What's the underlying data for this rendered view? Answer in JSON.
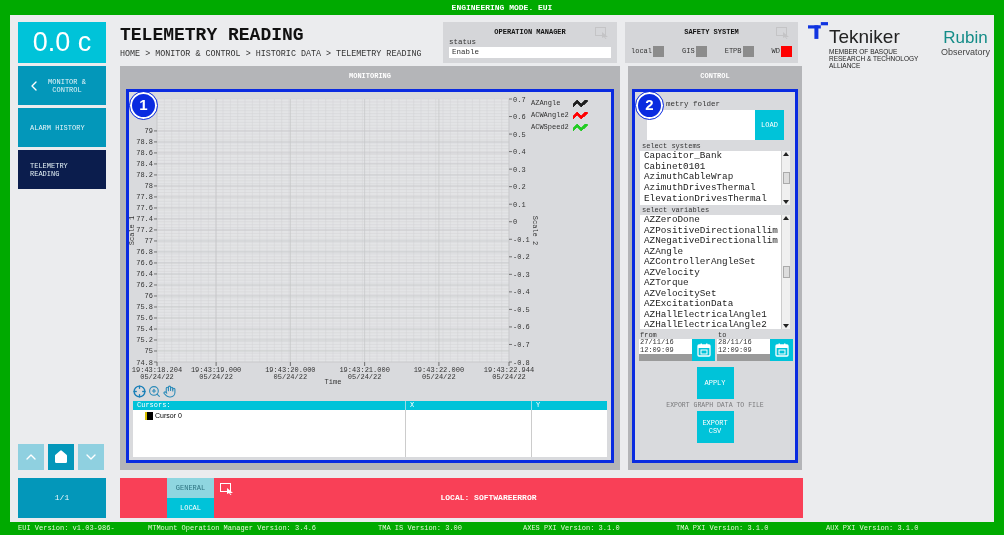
{
  "window": {
    "title": "ENGINEERING MODE. EUI"
  },
  "temperature": "0.0 c",
  "nav": [
    {
      "label": "MONITOR & CONTROL",
      "kind": "back",
      "selected": false
    },
    {
      "label": "ALARM HISTORY",
      "kind": "item",
      "selected": false
    },
    {
      "label": "TELEMETRY READING",
      "kind": "item",
      "selected": true
    }
  ],
  "page_nav": [
    {
      "kind": "up",
      "disabled": true
    },
    {
      "kind": "home",
      "disabled": false
    },
    {
      "kind": "down",
      "disabled": true
    }
  ],
  "page_indicator": "1/1",
  "header": {
    "title": "TELEMETRY READING",
    "breadcrumb": "HOME > MONITOR & CONTROL > HISTORIC DATA > TELEMETRY READING"
  },
  "operation_manager": {
    "title": "OPERATION MANAGER",
    "status_label": "status",
    "status": "Enable"
  },
  "safety_system": {
    "title": "SAFETY SYSTEM",
    "indicators": [
      {
        "label": "local",
        "color": "#8c8c8c"
      },
      {
        "label": "GIS",
        "color": "#8c8c8c"
      },
      {
        "label": "ETPB",
        "color": "#8c8c8c"
      },
      {
        "label": "WD",
        "color": "#ff0000"
      }
    ]
  },
  "logos": {
    "tekniker": {
      "name": "Tekniker",
      "tagline": "MEMBER OF BASQUE RESEARCH & TECHNOLOGY ALLIANCE"
    },
    "rubin": {
      "name": "Rubin",
      "subtitle": "Observatory"
    }
  },
  "monitoring": {
    "title": "MONITORING",
    "marker": "1",
    "chart": {
      "chart_data": {
        "type": "line",
        "xlabel": "Time",
        "ylabel": "Scale 1",
        "grid": true,
        "ylim": [
          74.8,
          79.58
        ],
        "categories": [
          "19:43:18.204 05/24/22",
          "19:43:19.000 05/24/22",
          "19:43:20.000 05/24/22",
          "19:43:21.000 05/24/22",
          "19:43:22.000 05/24/22",
          "19:43:22.944 05/24/22"
        ],
        "yticks": [
          74.8,
          75,
          75.2,
          75.4,
          75.6,
          75.8,
          76,
          76.2,
          76.4,
          76.6,
          76.8,
          77,
          77.2,
          77.4,
          77.6,
          77.8,
          78,
          78.2,
          78.4,
          78.6,
          78.8,
          79
        ],
        "series": [
          {
            "name": "AZAngle",
            "color": "#1e1e1e",
            "values": [
              null,
              null,
              null,
              null,
              null,
              null
            ]
          },
          {
            "name": "ACWAngle2",
            "color": "#ff0000",
            "values": [
              null,
              null,
              null,
              null,
              null,
              null
            ]
          },
          {
            "name": "ACWSpeed2",
            "color": "#22cc22",
            "values": [
              null,
              null,
              null,
              null,
              null,
              null
            ]
          }
        ]
      },
      "secondary_axis": {
        "label": "Scale 2",
        "ticks": [
          "0.7",
          "0.6",
          "0.5",
          "0.4",
          "0.3",
          "0.2",
          "0.1",
          "0",
          "-0.1",
          "-0.2",
          "-0.3",
          "-0.4",
          "-0.5",
          "-0.6",
          "-0.7",
          "-0.8"
        ]
      }
    },
    "cursors_table": {
      "columns": [
        "Cursors:",
        "X",
        "Y"
      ],
      "rows": [
        {
          "name": "Cursor 0"
        }
      ]
    }
  },
  "control": {
    "title": "CONTROL",
    "marker": "2",
    "folder_label": "metry folder",
    "load_button": "LOAD",
    "systems_label": "select systems",
    "systems": [
      "Capacitor_Bank",
      "Cabinet0101",
      "AzimuthCableWrap",
      "AzimuthDrivesThermal",
      "ElevationDrivesThermal"
    ],
    "variables_label": "select variables",
    "variables": [
      "AZZeroDone",
      "AZPositiveDirectionallim",
      "AZNegativeDirectionallim",
      "AZAngle",
      "AZControllerAngleSet",
      "AZVelocity",
      "AZTorque",
      "AZVelocitySet",
      "AZExcitationData",
      "AZHallElectricalAngle1",
      "AZHallElectricalAngle2"
    ],
    "from": {
      "label": "from",
      "value": "27/11/16 12:09:09"
    },
    "to": {
      "label": "to",
      "value": "28/11/16 12:09:09"
    },
    "apply_button": "APPLY",
    "export_label": "EXPORT GRAPH DATA TO FILE",
    "export_button": "EXPORT CSV"
  },
  "alarm_bar": {
    "tabs": [
      {
        "label": "GENERAL",
        "selected": false
      },
      {
        "label": "LOCAL",
        "selected": true
      }
    ],
    "message": "LOCAL: SOFTWAREERROR"
  },
  "footer": {
    "versions": [
      "EUI Version: v1.03-986-",
      "MTMount Operation Manager Version: 3.4.6",
      "TMA IS Version: 3.00",
      "AXES PXI Version: 3.1.0",
      "TMA PXI Version: 3.1.0",
      "AUX PXI Version: 3.1.0"
    ]
  }
}
